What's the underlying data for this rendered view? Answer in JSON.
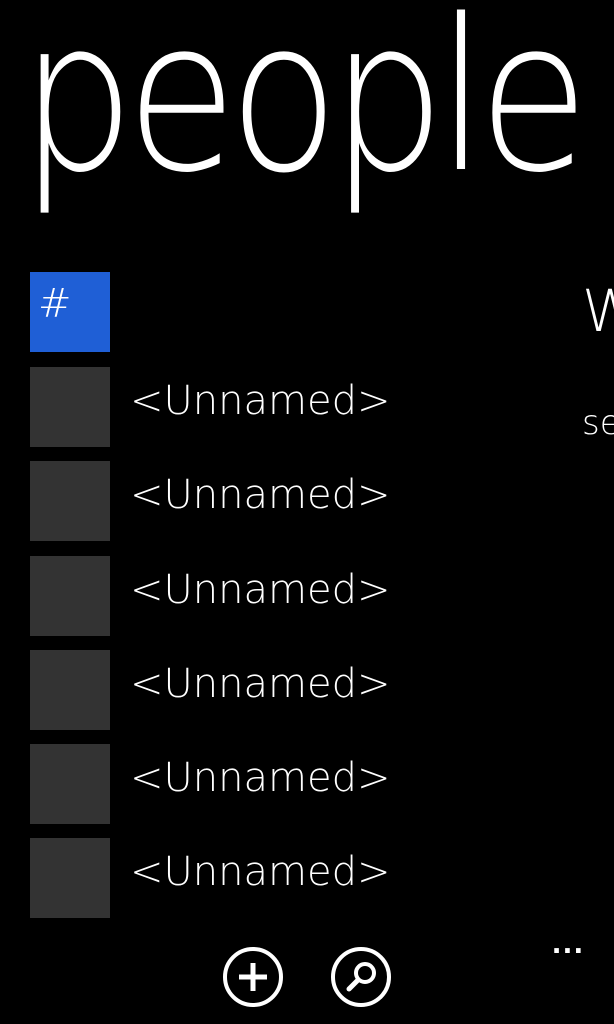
{
  "header": {
    "title": "people"
  },
  "list": {
    "group_letter": "#",
    "items": [
      {
        "name": "<Unnamed>"
      },
      {
        "name": "<Unnamed>"
      },
      {
        "name": "<Unnamed>"
      },
      {
        "name": "<Unnamed>"
      },
      {
        "name": "<Unnamed>"
      },
      {
        "name": "<Unnamed>"
      }
    ]
  },
  "next_pivot_peek": {
    "heading_fragment": "W",
    "text_fragment": "se"
  },
  "app_bar": {
    "more_label": "..."
  },
  "colors": {
    "background": "#000000",
    "accent": "#1f5fd6",
    "tile": "#333333",
    "text": "#ffffff"
  },
  "icons": {
    "add": "add-icon",
    "search": "search-icon"
  }
}
